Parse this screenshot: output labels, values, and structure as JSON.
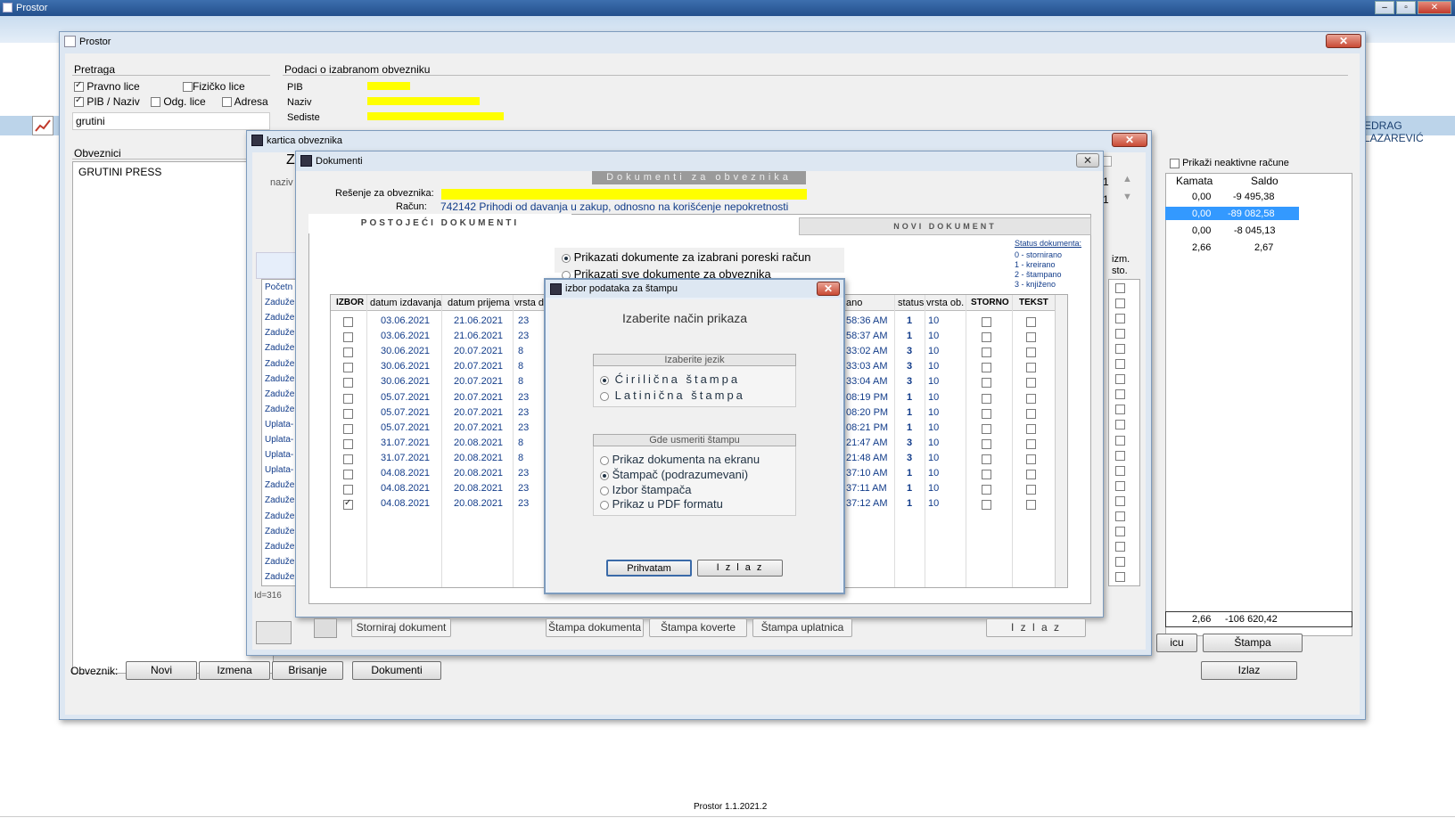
{
  "taskbar": {
    "title": "Prostor",
    "min": "–",
    "max": "▫",
    "close": "✕"
  },
  "user": "EDRAG LAZAREVIĆ",
  "footer": "Prostor 1.1.2021.2",
  "prostor": {
    "title": "Prostor",
    "pretraga": "Pretraga",
    "pravno": "Pravno lice",
    "fizicko": "Fizičko lice",
    "pib_naziv": "PIB / Naziv",
    "odg": "Odg. lice",
    "adresa": "Adresa",
    "search_value": "grutini",
    "obveznici": "Obveznici",
    "list": [
      "GRUTINI PRESS"
    ],
    "podaci": "Podaci o izabranom obvezniku",
    "pib": "PIB",
    "naziv": "Naziv",
    "sediste": "Sediste",
    "obveznik_label": "Obveznik:",
    "btn_novi": "Novi",
    "btn_izmena": "Izmena",
    "btn_brisanje": "Brisanje",
    "btn_dokumenti": "Dokumenti",
    "btn_izlaz": "Izlaz",
    "neaktivne": "Prikaži neaktivne račune",
    "kamata": "Kamata",
    "saldo": "Saldo",
    "rows": [
      [
        "0,00",
        "-9 495,38"
      ],
      [
        "0,00",
        "-89 082,58"
      ],
      [
        "0,00",
        "-8 045,13"
      ],
      [
        "2,66",
        "2,67"
      ]
    ],
    "total_kamata": "2,66",
    "total_saldo": "-106 620,42",
    "btn_stampa": "Štampa",
    "btn_icu": "icu"
  },
  "kartica": {
    "title": "kartica obveznika",
    "naziv": "naziv",
    "z": "Z",
    "izm_sto": "izm. sto.",
    "id": "Id=316",
    "types": [
      "Početn",
      "Zaduže",
      "Zaduže",
      "Zaduže",
      "Zaduže",
      "Zaduže",
      "Zaduže",
      "Zaduže",
      "Zaduže",
      "Uplata-",
      "Uplata-",
      "Uplata-",
      "Uplata-",
      "Zaduže",
      "Zaduže",
      "Zaduže",
      "Zaduže",
      "Zaduže",
      "Zaduže",
      "Zaduže"
    ],
    "spin1": "1",
    "spin2": "1"
  },
  "dokumenti": {
    "title": "Dokumenti",
    "header": "Dokumenti za obveznika",
    "resenje_label": "Rešenje za obveznika:",
    "racun_label": "Račun:",
    "racun_value": "742142  Prihodi od davanja u zakup, odnosno na korišćenje nepokretnosti",
    "tab_postojeci": "POSTOJEĆI DOKUMENTI",
    "tab_novi": "NOVI DOKUMENT",
    "opt1": "Prikazati dokumente za izabrani poreski račun",
    "opt2": "Prikazati sve dokumente za obveznika",
    "status_title": "Status dokumenta:",
    "status": [
      "0 - stornirano",
      "1 - kreirano",
      "2 - štampano",
      "3 - knjiženo"
    ],
    "cols": {
      "izbor": "IZBOR",
      "izdavanja": "datum izdavanja",
      "prijema": "datum prijema",
      "vrsta_d": "vrsta d",
      "ano": "ano",
      "status": "status",
      "vrsta_ob": "vrsta ob.",
      "storno": "STORNO",
      "tekst": "TEKST"
    },
    "rows": [
      {
        "izd": "03.06.2021",
        "pri": "21.06.2021",
        "vd": "23",
        "time": "58:36 AM",
        "st": "1",
        "vo": "10",
        "chk": false
      },
      {
        "izd": "03.06.2021",
        "pri": "21.06.2021",
        "vd": "23",
        "time": "58:37 AM",
        "st": "1",
        "vo": "10",
        "chk": false
      },
      {
        "izd": "30.06.2021",
        "pri": "20.07.2021",
        "vd": "8",
        "time": "33:02 AM",
        "st": "3",
        "vo": "10",
        "chk": false
      },
      {
        "izd": "30.06.2021",
        "pri": "20.07.2021",
        "vd": "8",
        "time": "33:03 AM",
        "st": "3",
        "vo": "10",
        "chk": false
      },
      {
        "izd": "30.06.2021",
        "pri": "20.07.2021",
        "vd": "8",
        "time": "33:04 AM",
        "st": "3",
        "vo": "10",
        "chk": false
      },
      {
        "izd": "05.07.2021",
        "pri": "20.07.2021",
        "vd": "23",
        "time": "08:19 PM",
        "st": "1",
        "vo": "10",
        "chk": false
      },
      {
        "izd": "05.07.2021",
        "pri": "20.07.2021",
        "vd": "23",
        "time": "08:20 PM",
        "st": "1",
        "vo": "10",
        "chk": false
      },
      {
        "izd": "05.07.2021",
        "pri": "20.07.2021",
        "vd": "23",
        "time": "08:21 PM",
        "st": "1",
        "vo": "10",
        "chk": false
      },
      {
        "izd": "31.07.2021",
        "pri": "20.08.2021",
        "vd": "8",
        "time": "21:47 AM",
        "st": "3",
        "vo": "10",
        "chk": false
      },
      {
        "izd": "31.07.2021",
        "pri": "20.08.2021",
        "vd": "8",
        "time": "21:48 AM",
        "st": "3",
        "vo": "10",
        "chk": false
      },
      {
        "izd": "04.08.2021",
        "pri": "20.08.2021",
        "vd": "23",
        "time": "37:10 AM",
        "st": "1",
        "vo": "10",
        "chk": false
      },
      {
        "izd": "04.08.2021",
        "pri": "20.08.2021",
        "vd": "23",
        "time": "37:11 AM",
        "st": "1",
        "vo": "10",
        "chk": false
      },
      {
        "izd": "04.08.2021",
        "pri": "20.08.2021",
        "vd": "23",
        "time": "37:12 AM",
        "st": "1",
        "vo": "10",
        "chk": true
      }
    ],
    "btn_storniraj": "Storniraj dokument",
    "btn_stampa_dok": "Štampa dokumenta",
    "btn_koverte": "Štampa koverte",
    "btn_uplatnica": "Štampa uplatnica",
    "btn_izlaz": "I z l a z"
  },
  "dialog": {
    "title": "izbor podataka za štampu",
    "heading": "Izaberite način prikaza",
    "jezik_title": "Izaberite jezik",
    "cirilicna": "Ćirilična   štampa",
    "latinicna": "Latinična   štampa",
    "gde_title": "Gde usmeriti štampu",
    "opt_ekran": "Prikaz dokumenta na ekranu",
    "opt_stampac": "Štampač  (podrazumevani)",
    "opt_izbor": "Izbor štampača",
    "opt_pdf": "Prikaz u PDF formatu",
    "btn_prihvatam": "Prihvatam",
    "btn_izlaz": "I z l a z"
  },
  "colors": {
    "highlight": "#3399ff",
    "titlebar": "#dde7f2",
    "redaction": "#ffff00"
  }
}
